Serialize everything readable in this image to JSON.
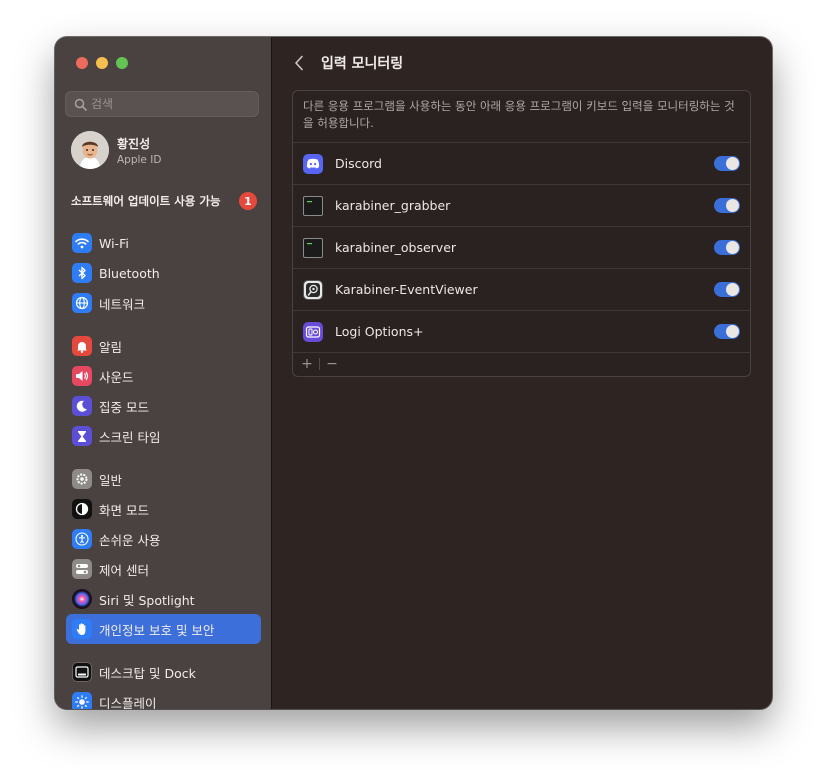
{
  "window": {
    "title": "입력 모니터링"
  },
  "sidebar": {
    "search_placeholder": "검색",
    "profile": {
      "name": "황진성",
      "subtitle": "Apple ID"
    },
    "update": {
      "label": "소프트웨어 업데이트 사용 가능",
      "badge": "1"
    },
    "items": [
      {
        "label": "Wi-Fi",
        "icon": "wifi-icon",
        "color": "#2f7df6"
      },
      {
        "label": "Bluetooth",
        "icon": "bluetooth-icon",
        "color": "#2f7df6"
      },
      {
        "label": "네트워크",
        "icon": "globe-icon",
        "color": "#2f7df6"
      },
      {
        "label": "알림",
        "icon": "bell-icon",
        "color": "#e5483c"
      },
      {
        "label": "사운드",
        "icon": "speaker-icon",
        "color": "#e5485f"
      },
      {
        "label": "집중 모드",
        "icon": "moon-icon",
        "color": "#5b4fd6"
      },
      {
        "label": "스크린 타임",
        "icon": "hourglass-icon",
        "color": "#5b4fd6"
      },
      {
        "label": "일반",
        "icon": "gear-icon",
        "color": "#8e8a88"
      },
      {
        "label": "화면 모드",
        "icon": "appearance-icon",
        "color": "#111111"
      },
      {
        "label": "손쉬운 사용",
        "icon": "accessibility-icon",
        "color": "#2f7df6"
      },
      {
        "label": "제어 센터",
        "icon": "control-center-icon",
        "color": "#8e8a88"
      },
      {
        "label": "Siri 및 Spotlight",
        "icon": "siri-icon",
        "color": "#7b3fd0"
      },
      {
        "label": "개인정보 보호 및 보안",
        "icon": "hand-icon",
        "color": "#2f7df6"
      },
      {
        "label": "데스크탑 및 Dock",
        "icon": "dock-icon",
        "color": "#111111"
      },
      {
        "label": "디스플레이",
        "icon": "sun-icon",
        "color": "#2f7df6"
      }
    ],
    "active_item": "개인정보 보호 및 보안"
  },
  "main": {
    "description": "다른 응용 프로그램을 사용하는 동안 아래 응용 프로그램이 키보드 입력을 모니터링하는 것을 허용합니다.",
    "apps": [
      {
        "name": "Discord",
        "icon": "discord-icon",
        "enabled": true
      },
      {
        "name": "karabiner_grabber",
        "icon": "terminal-icon",
        "enabled": true
      },
      {
        "name": "karabiner_observer",
        "icon": "terminal-icon",
        "enabled": true
      },
      {
        "name": "Karabiner-EventViewer",
        "icon": "karabiner-eventviewer-icon",
        "enabled": true
      },
      {
        "name": "Logi Options+",
        "icon": "logi-options-icon",
        "enabled": true
      }
    ],
    "footer": {
      "add": "+",
      "remove": "−"
    }
  },
  "colors": {
    "accent": "#3c6fd9",
    "toggle_on": "#3a6fd7",
    "sidebar_bg": "#4a4240",
    "content_bg": "#2e2523"
  }
}
